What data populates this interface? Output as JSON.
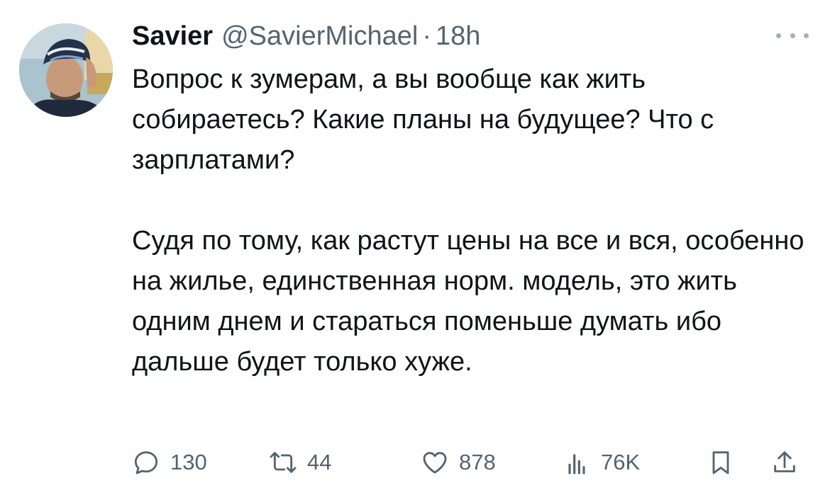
{
  "author": {
    "name": "Savier",
    "handle": "@SavierMichael",
    "separator": "·",
    "time": "18h"
  },
  "tweet": {
    "paragraph1": "Вопрос к зумерам, а вы вообще как жить собираетесь? Какие планы на будущее? Что с зарплатами?",
    "paragraph2": "Судя по тому, как растут цены на все и вся, особенно на жилье, единственная норм. модель, это жить одним днем и стараться поменьше думать ибо дальше будет только хуже."
  },
  "actions": {
    "replies": "130",
    "retweets": "44",
    "likes": "878",
    "views": "76K"
  },
  "icons": {
    "more": "more-horizontal-icon",
    "reply": "reply-icon",
    "retweet": "retweet-icon",
    "like": "heart-icon",
    "views": "analytics-icon",
    "bookmark": "bookmark-icon",
    "share": "share-icon"
  },
  "colors": {
    "text": "#0f1419",
    "secondary": "#536471",
    "background": "#ffffff"
  }
}
